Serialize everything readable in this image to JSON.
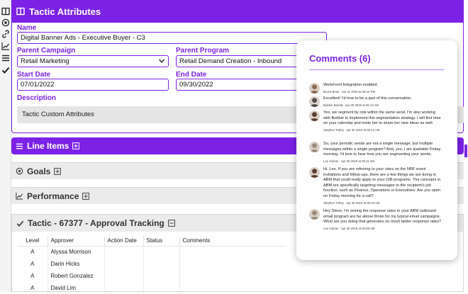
{
  "rail": {
    "icons": [
      "panel-icon",
      "target-icon",
      "link-icon",
      "chart-icon",
      "list-icon",
      "check-icon"
    ]
  },
  "attributes": {
    "title": "Tactic Attributes",
    "name": {
      "label": "Name",
      "value": "Digital Banner Ads - Executive Buyer - C3"
    },
    "parent_campaign": {
      "label": "Parent Campaign",
      "value": "Retail Marketing"
    },
    "parent_program": {
      "label": "Parent Program",
      "value": "Retail Demand Creation - Inbound"
    },
    "start_date": {
      "label": "Start Date",
      "value": "07/01/2022"
    },
    "end_date": {
      "label": "End Date",
      "value": "09/30/2022"
    },
    "description": {
      "label": "Description"
    },
    "custom_attributes": "Tactic Custom Attributes"
  },
  "sections": {
    "line_items": "Line Items",
    "goals": "Goals",
    "performance": "Performance",
    "approval": "Tactic - 67377 - Approval Tracking"
  },
  "approvals": {
    "columns": [
      "Level",
      "Approver",
      "Action Date",
      "Status",
      "Comments"
    ],
    "rows": [
      {
        "level": "A",
        "approver": "Alyssa Morrison",
        "action_date": "",
        "status": "",
        "comments": ""
      },
      {
        "level": "A",
        "approver": "Darin Hicks",
        "action_date": "",
        "status": "",
        "comments": ""
      },
      {
        "level": "A",
        "approver": "Robert Gonzalez",
        "action_date": "",
        "status": "",
        "comments": ""
      },
      {
        "level": "A",
        "approver": "David Lim",
        "action_date": "",
        "status": "",
        "comments": ""
      }
    ]
  },
  "comments": {
    "title": "Comments (6)",
    "items": [
      {
        "text": "WorkFront Integration enabled.",
        "author": "Bruce Brian",
        "date": "Jun 11 2020 at 06:16 PM",
        "avatar_color": "#8d6a4f"
      },
      {
        "text": "Excellent! I'd love to be a part of this conversation.",
        "author": "Bobbie Barrett",
        "date": "Apr 30 2019 at 06:13 AM",
        "avatar_color": "#4a4a4a"
      },
      {
        "text": "Yes, we segment by role within the same send. I'm also working with Bobbie to implement this segmentation strategy. I will find time on your calendar and invite her to share her new ideas as well.",
        "author": "Stephen Turley",
        "date": "Apr 30 2019 at 06:12 AM",
        "avatar_color": "#5b3d2e"
      },
      {
        "text": "So, your periodic sends are not a single message, but multiple messages within a single program? And, yes, I am available Friday morning. I'd love to hear how you are segmenting your sends.",
        "author": "Lee Garner",
        "date": "Apr 30 2019 at 06:11 AM",
        "avatar_color": "#9a8a7a"
      },
      {
        "text": "Hi, Lee. If you are referring to your rates on the NRF event invitations and follow-ups, there are a few things we are doing in ABM that could really apply to your O/B programs. The concepts in ABM are specifically targeting messages to the recipient's job function, such as Finance, Operations or Executives. Are you open on Friday morning for a call?",
        "author": "Stephen Turley",
        "date": "Apr 30 2019 at 06:10 AM",
        "avatar_color": "#5b3d2e"
      },
      {
        "text": "Hey Steve, I'm seeing the response rates to your ABM outbound email program are far above those for my typical email campaigns. What are you doing that generates so much better response rates?",
        "author": "Lee Garner",
        "date": "Apr 30 2019 at 06:08 AM",
        "avatar_color": "#9a8a7a"
      }
    ]
  },
  "colors": {
    "accent": "#7b22e6",
    "bar_grey": "#ebebeb",
    "custom_attr_bg": "#e5e5e5"
  }
}
